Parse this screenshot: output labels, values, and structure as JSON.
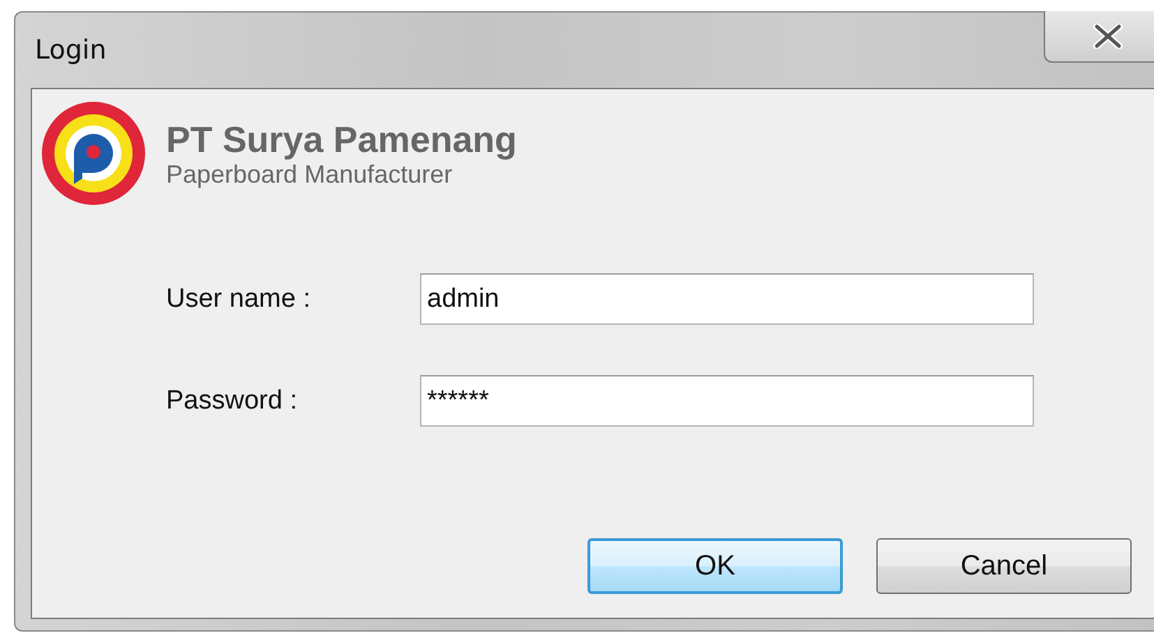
{
  "window": {
    "title": "Login"
  },
  "company": {
    "name": "PT Surya Pamenang",
    "tagline": "Paperboard Manufacturer"
  },
  "fields": [
    {
      "label": "User name :",
      "value": "admin"
    },
    {
      "label": "Password :",
      "value": "******"
    }
  ],
  "buttons": [
    {
      "label": "OK",
      "default": true
    },
    {
      "label": "Cancel",
      "default": false
    }
  ]
}
